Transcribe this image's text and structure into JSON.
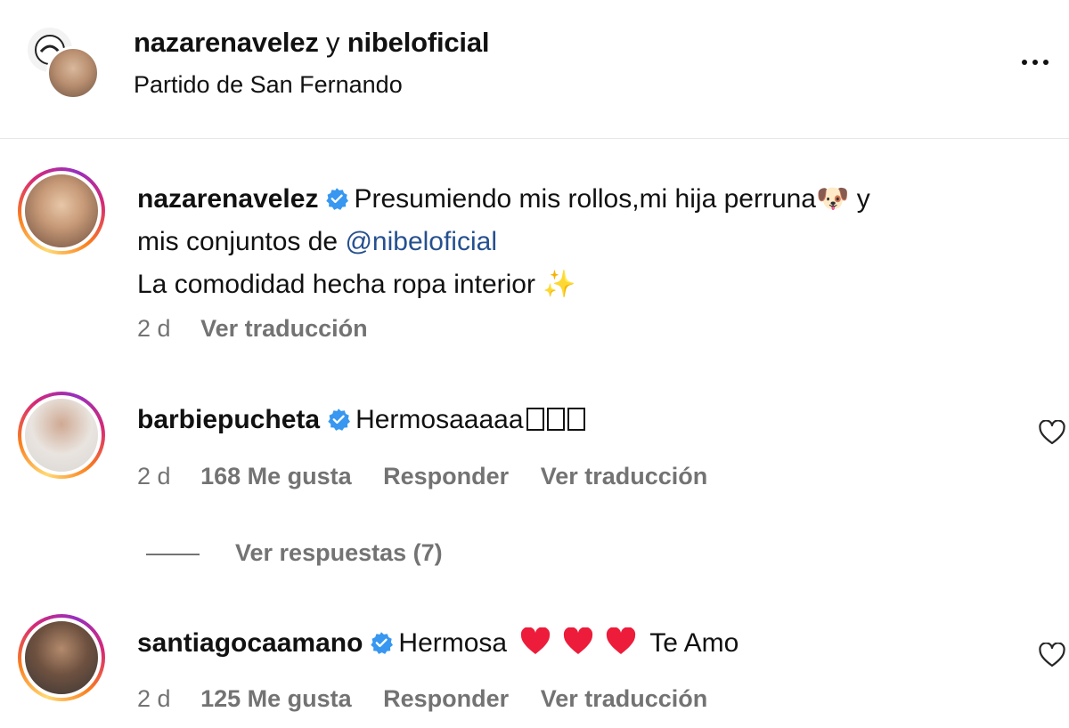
{
  "header": {
    "user1": "nazarenavelez",
    "conjunction": " y ",
    "user2": "nibeloficial",
    "location": "Partido de San Fernando"
  },
  "post": {
    "username": "nazarenavelez",
    "caption_line1": "Presumiendo mis rollos,mi hija perruna",
    "caption_after_emoji": " y",
    "caption_line2_prefix": "mis conjuntos de ",
    "mention": "@nibeloficial",
    "caption_line3": "La comodidad hecha ropa interior",
    "dog_emoji": "🐶",
    "sparkle_emoji": "✨",
    "time": "2 d",
    "translate_label": "Ver traducción"
  },
  "comments": [
    {
      "username": "barbiepucheta",
      "text": "Hermosaaaaa",
      "time": "2 d",
      "likes_label": "168 Me gusta",
      "reply_label": "Responder",
      "translate_label": "Ver traducción"
    },
    {
      "username": "santiagocaamano",
      "text": "Hermosa",
      "text_after": "Te Amo",
      "time": "2 d",
      "likes_label": "125 Me gusta",
      "reply_label": "Responder",
      "translate_label": "Ver traducción"
    }
  ],
  "replies_label": "Ver respuestas (7)",
  "colors": {
    "verified": "#3897f0",
    "secondary_text": "#737373",
    "mention": "#26508f",
    "heart_red": "#ed1c3a"
  },
  "icons": [
    "more-icon",
    "verified-badge-icon",
    "heart-outline-icon",
    "red-heart-icon"
  ]
}
